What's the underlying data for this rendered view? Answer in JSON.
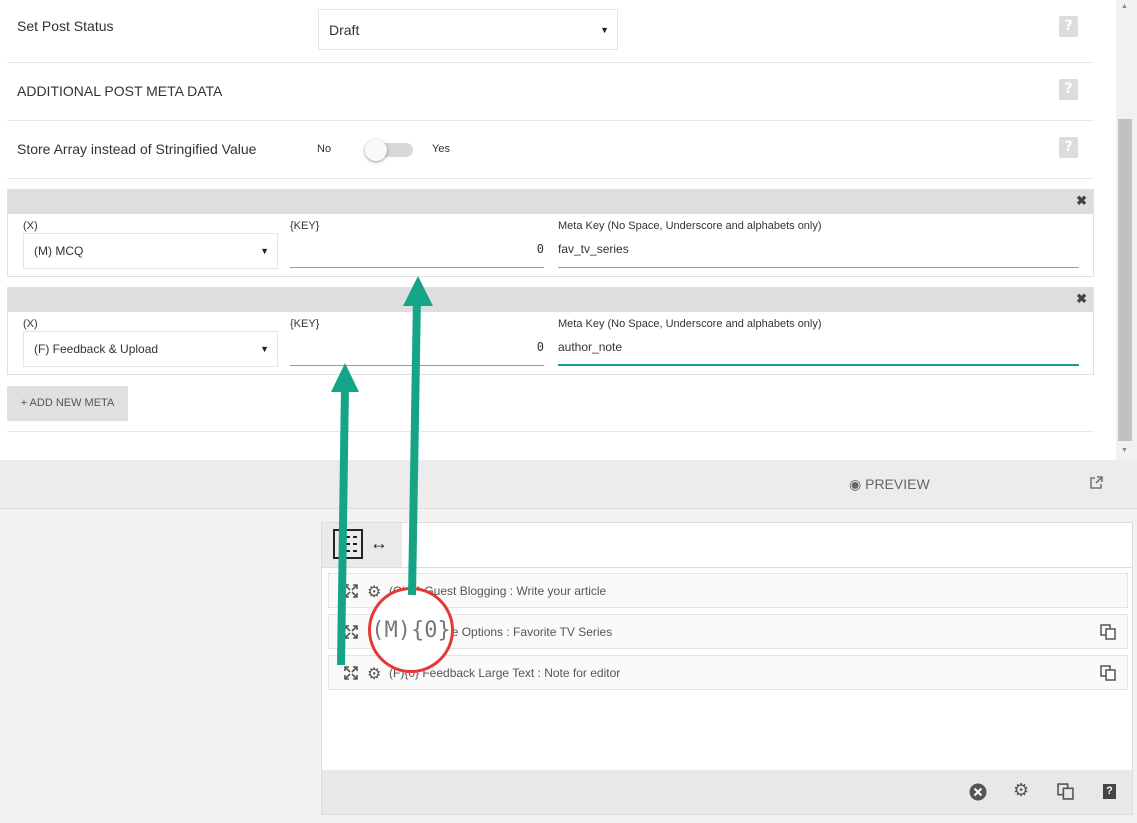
{
  "settings": {
    "post_status_label": "Set Post Status",
    "post_status_value": "Draft",
    "additional_meta_heading": "ADDITIONAL POST META DATA",
    "store_array_label": "Store Array instead of Stringified Value",
    "toggle_no": "No",
    "toggle_yes": "Yes",
    "toggle_on": false,
    "help_glyph": "?"
  },
  "meta_rows": [
    {
      "x_label": "(X)",
      "x_value": "(M) MCQ",
      "key_label": "{KEY}",
      "key_value": "0",
      "meta_key_label": "Meta Key (No Space, Underscore and alphabets only)",
      "meta_key_value": "fav_tv_series"
    },
    {
      "x_label": "(X)",
      "x_value": "(F) Feedback & Upload",
      "key_label": "{KEY}",
      "key_value": "0",
      "meta_key_label": "Meta Key (No Space, Underscore and alphabets only)",
      "meta_key_value": "author_note"
    }
  ],
  "close_glyph": "✖",
  "add_meta_button": "+ ADD NEW META",
  "preview_label": "PREVIEW",
  "panel": {
    "tab_arrows": "↔",
    "fields": [
      {
        "text": "(O){1} Guest Blogging : Write your article",
        "has_copy": false
      },
      {
        "text": "(M){0} Single Options : Favorite TV Series",
        "has_copy": true
      },
      {
        "text": "(F){0} Feedback Large Text : Note for editor",
        "has_copy": true
      }
    ],
    "zoom_text": "(M){0}"
  },
  "colors": {
    "accent": "#1a9e86",
    "arrow": "#16a487",
    "circle": "#e53935"
  }
}
